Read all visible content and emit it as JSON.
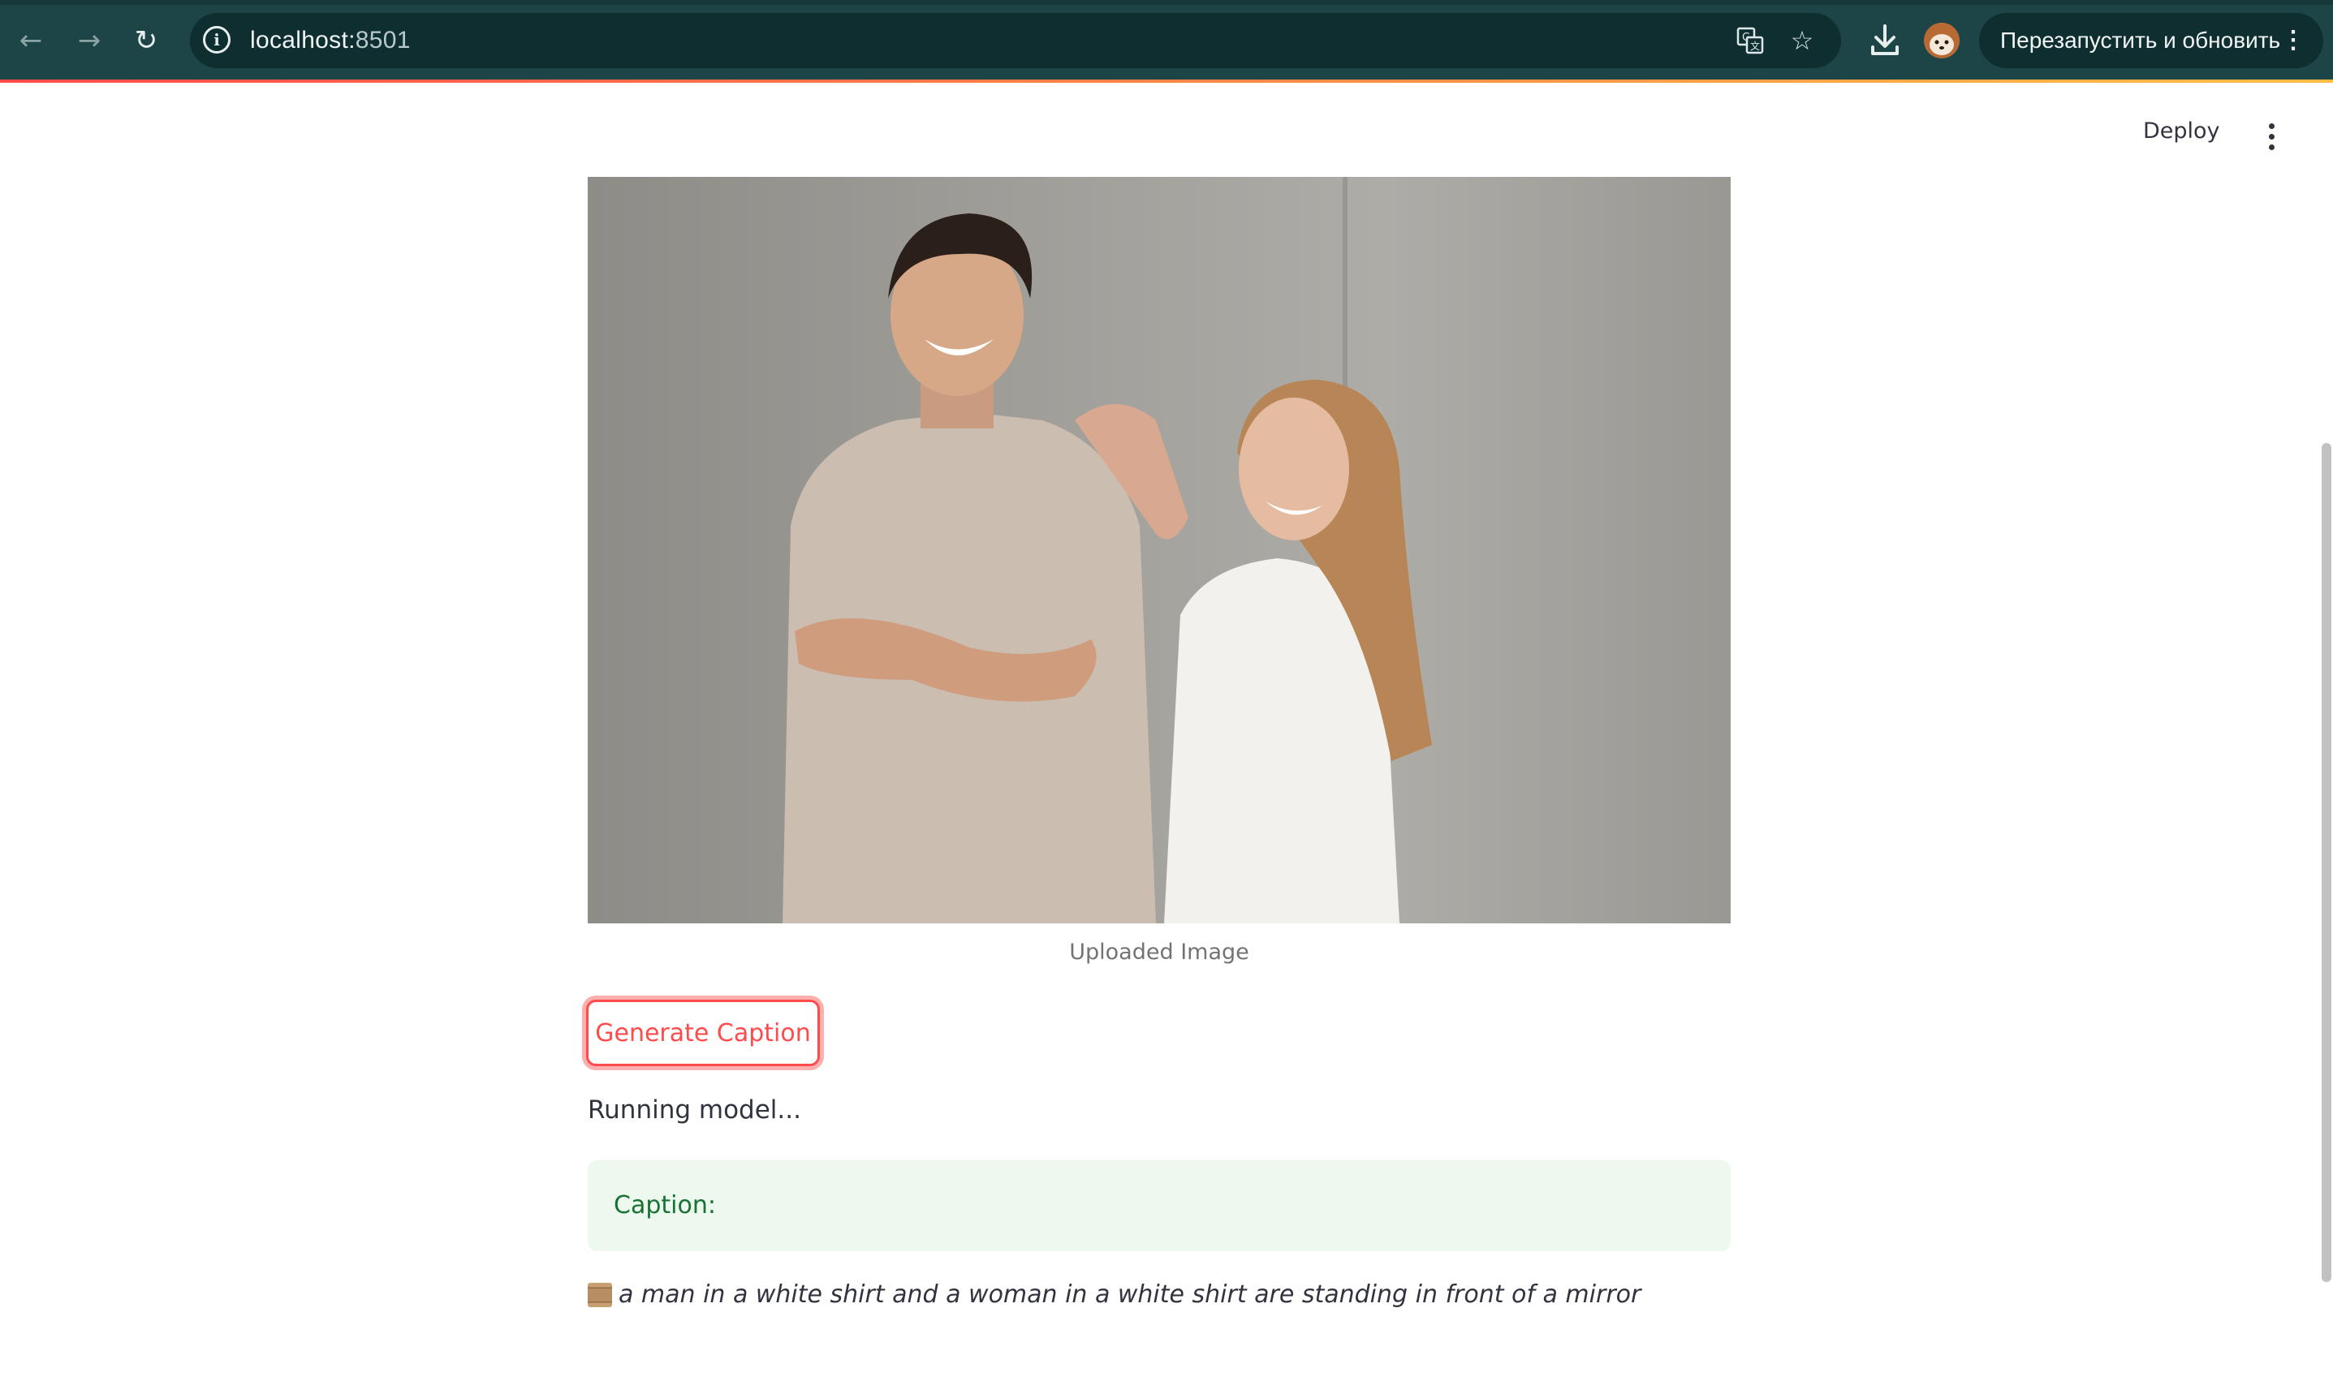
{
  "browser": {
    "url_host": "localhost:",
    "url_port": "8501",
    "relaunch_label": "Перезапустить и обновить"
  },
  "app": {
    "deploy_label": "Deploy",
    "image_caption": "Uploaded Image",
    "generate_button": "Generate Caption",
    "status": "Running model...",
    "success_label": "Caption:",
    "result_text": "a man in a white shirt and a woman in a white shirt are standing in front of a mirror"
  },
  "colors": {
    "accent": "#ff4b4b",
    "success_bg": "#edf8ee",
    "success_text": "#177233",
    "browser_chrome": "#1d4547"
  },
  "icons": {
    "back": "arrow-left-icon",
    "forward": "arrow-right-icon",
    "reload": "reload-icon",
    "site_info": "info-icon",
    "translate": "translate-icon",
    "bookmark": "star-icon",
    "download": "download-icon",
    "menu": "more-vertical-icon",
    "result_prefix": "scroll-icon"
  }
}
